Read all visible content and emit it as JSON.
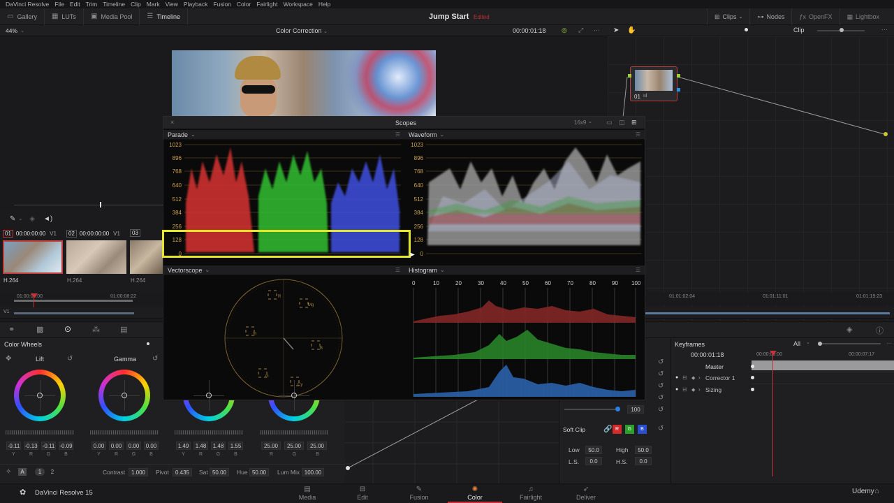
{
  "menubar": {
    "items": [
      "DaVinci Resolve",
      "File",
      "Edit",
      "Trim",
      "Timeline",
      "Clip",
      "Mark",
      "View",
      "Playback",
      "Fusion",
      "Color",
      "Fairlight",
      "Workspace",
      "Help"
    ]
  },
  "topbar": {
    "left_buttons": [
      {
        "label": "Gallery",
        "icon": "gallery-icon"
      },
      {
        "label": "LUTs",
        "icon": "luts-icon"
      },
      {
        "label": "Media Pool",
        "icon": "media-pool-icon"
      },
      {
        "label": "Timeline",
        "icon": "timeline-icon"
      }
    ],
    "project_title": "Jump Start",
    "project_status": "Edited",
    "right_buttons": [
      {
        "label": "Clips",
        "icon": "clips-icon"
      },
      {
        "label": "Nodes",
        "icon": "nodes-icon"
      },
      {
        "label": "OpenFX",
        "icon": "openfx-icon"
      },
      {
        "label": "Lightbox",
        "icon": "lightbox-icon"
      }
    ]
  },
  "viewer": {
    "zoom": "44%",
    "mode": "Color Correction",
    "timecode": "00:00:01:18",
    "node_mode": "Clip"
  },
  "clips": {
    "items": [
      {
        "index": "01",
        "timecode": "00:00:00:00",
        "track": "V1",
        "codec": "H.264"
      },
      {
        "index": "02",
        "timecode": "00:00:00:00",
        "track": "V1",
        "codec": "H.264"
      },
      {
        "index": "03",
        "timecode": "",
        "track": "",
        "codec": "H.264"
      }
    ]
  },
  "timeline": {
    "ruler_left": [
      "01:00:00:00",
      "01:00:08:22"
    ],
    "ruler_right": [
      "01:01:02:04",
      "01:01:11:01",
      "01:01:19:23"
    ],
    "track": "V1"
  },
  "node": {
    "label": "01"
  },
  "scopes": {
    "title": "Scopes",
    "aspect": "16x9",
    "panels": {
      "parade": "Parade",
      "waveform": "Waveform",
      "vectorscope": "Vectorscope",
      "histogram": "Histogram"
    },
    "y_axis": [
      "1023",
      "896",
      "768",
      "640",
      "512",
      "384",
      "256",
      "128",
      "0"
    ],
    "hist_axis": [
      "0",
      "10",
      "20",
      "30",
      "40",
      "50",
      "60",
      "70",
      "80",
      "90",
      "100"
    ],
    "vector_targets": [
      "R",
      "Mg",
      "Yl",
      "B",
      "G",
      "Cy"
    ]
  },
  "color_wheels": {
    "title": "Color Wheels",
    "wheels": [
      {
        "label": "Lift",
        "values": [
          "-0.11",
          "-0.13",
          "-0.11",
          "-0.09"
        ]
      },
      {
        "label": "Gamma",
        "values": [
          "0.00",
          "0.00",
          "0.00",
          "0.00"
        ]
      },
      {
        "label": "",
        "values": [
          "1.49",
          "1.48",
          "1.48",
          "1.55"
        ]
      },
      {
        "label": "",
        "values": [
          "25.00",
          "25.00",
          "25.00"
        ]
      }
    ],
    "channels": [
      "Y",
      "R",
      "G",
      "B"
    ],
    "channels3": [
      "R",
      "G",
      "B"
    ],
    "pages": [
      "1",
      "2"
    ],
    "footer": {
      "contrast_label": "Contrast",
      "contrast": "1.000",
      "pivot_label": "Pivot",
      "pivot": "0.435",
      "sat_label": "Sat",
      "sat": "50.00",
      "hue_label": "Hue",
      "hue": "50.00",
      "lummix_label": "Lum Mix",
      "lummix": "100.00"
    }
  },
  "qualifier": {
    "value": "100",
    "soft_clip": "Soft Clip",
    "rgb": [
      "R",
      "G",
      "B"
    ],
    "low_label": "Low",
    "low": "50.0",
    "high_label": "High",
    "high": "50.0",
    "ls_label": "L.S.",
    "ls": "0.0",
    "hs_label": "H.S.",
    "hs": "0.0"
  },
  "keyframes": {
    "title": "Keyframes",
    "filter": "All",
    "timecode": "00:00:01:18",
    "ruler": [
      "00:00:00:00",
      "00:00:07:17"
    ],
    "rows": [
      "Master",
      "Corrector 1",
      "Sizing"
    ]
  },
  "pages": {
    "items": [
      {
        "label": "Media",
        "icon": "media-page-icon"
      },
      {
        "label": "Edit",
        "icon": "edit-page-icon"
      },
      {
        "label": "Fusion",
        "icon": "fusion-page-icon"
      },
      {
        "label": "Color",
        "icon": "color-page-icon"
      },
      {
        "label": "Fairlight",
        "icon": "fairlight-page-icon"
      },
      {
        "label": "Deliver",
        "icon": "deliver-page-icon"
      }
    ],
    "app_name": "DaVinci Resolve 15",
    "watermark": "Udemy"
  },
  "colors": {
    "accent_red": "#c8323a",
    "highlight_yellow": "#e6e62a",
    "node_border": "#c04040"
  }
}
